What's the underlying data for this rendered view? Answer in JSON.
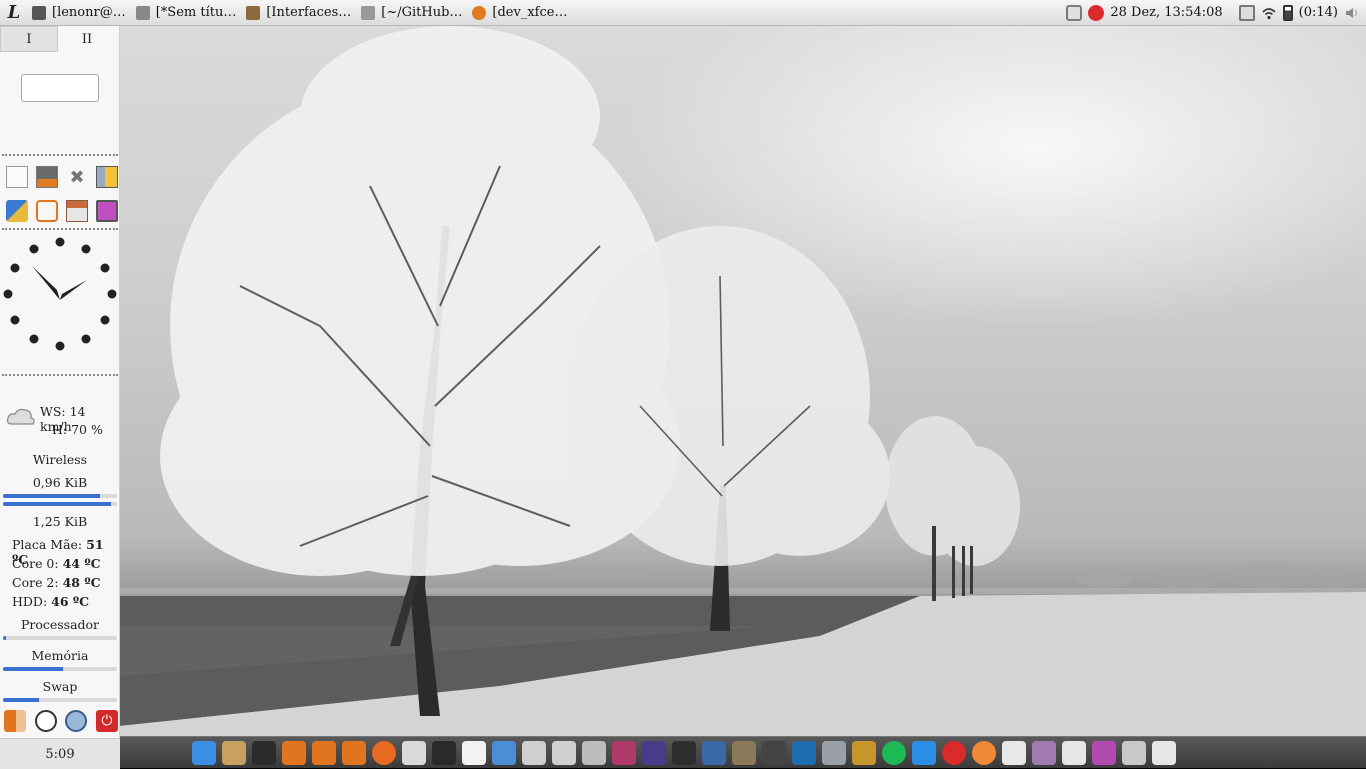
{
  "top_panel": {
    "menu_logo": "L",
    "tasks": [
      {
        "label": "[lenonr@…",
        "icon": "terminal-icon",
        "color": "#555555"
      },
      {
        "label": "[*Sem títu…",
        "icon": "text-editor-icon",
        "color": "#888888"
      },
      {
        "label": "[Interfaces…",
        "icon": "file-manager-icon",
        "color": "#8a6a3a"
      },
      {
        "label": "[~/GitHub…",
        "icon": "editor-pen-icon",
        "color": "#999999"
      },
      {
        "label": "[dev_xfce…",
        "icon": "firefox-icon",
        "color": "#e07b20"
      }
    ],
    "tray": {
      "clock_text": "28 Dez, 13:54:08",
      "battery_text": "(0:14)",
      "icons": [
        "dropbox-sync-icon",
        "mega-icon",
        "clipboard-icon",
        "wifi-icon",
        "battery-icon",
        "volume-icon"
      ]
    }
  },
  "sidebar": {
    "workspaces": [
      {
        "label": "I",
        "active": true
      },
      {
        "label": "II",
        "active": false
      }
    ],
    "launchers": [
      "notes-icon",
      "screenshot-icon",
      "close-x-icon",
      "battery-manager-icon",
      "cleaner-brush-icon",
      "xampp-icon",
      "archive-manager-icon",
      "window-manager-icon"
    ],
    "weather": {
      "wind": "WS: 14 km/h",
      "humidity": "H: 70 %"
    },
    "network": {
      "label": "Wireless",
      "down_rate": "0,96 KiB",
      "up_rate": "1,25 KiB",
      "down_level": 0.85,
      "up_level": 0.95
    },
    "temps": [
      {
        "label": "Placa Mãe:",
        "value": "51 ºC"
      },
      {
        "label": "Core 0:",
        "value": "44 ºC"
      },
      {
        "label": "Core 2:",
        "value": "48 ºC"
      },
      {
        "label": "HDD:",
        "value": "46 ºC"
      }
    ],
    "processor": {
      "label": "Processador",
      "level": 0.03
    },
    "memory": {
      "label": "Memória",
      "level": 0.53
    },
    "swap": {
      "label": "Swap",
      "level": 0.32
    },
    "system_buttons": [
      "logout-icon",
      "clock-settings-icon",
      "network-settings-icon",
      "power-icon"
    ],
    "uptime": "5:09"
  },
  "dock": [
    {
      "icon": "desktop-icon",
      "color": "#3a8ee6"
    },
    {
      "icon": "file-manager-icon",
      "color": "#c8a060"
    },
    {
      "icon": "app-grid-icon",
      "color": "#2b2b2b"
    },
    {
      "icon": "workspace-grid-icon",
      "color": "#e0741f"
    },
    {
      "icon": "workspace-grid-icon",
      "color": "#e0741f"
    },
    {
      "icon": "workspace-grid-icon",
      "color": "#e0741f"
    },
    {
      "icon": "firefox-icon",
      "color": "#e66a1f"
    },
    {
      "icon": "text-editor-icon",
      "color": "#d9d9d9"
    },
    {
      "icon": "terminal-icon",
      "color": "#2a2a2a"
    },
    {
      "icon": "document-icon",
      "color": "#f2f2f2"
    },
    {
      "icon": "writer-icon",
      "color": "#4a8fd6"
    },
    {
      "icon": "camera-icon",
      "color": "#cfcfcf"
    },
    {
      "icon": "draw-icon",
      "color": "#d0d0d0"
    },
    {
      "icon": "calculator-icon",
      "color": "#bdbdbd"
    },
    {
      "icon": "media-player-icon",
      "color": "#b03a6a"
    },
    {
      "icon": "astronomy-icon",
      "color": "#4a3a8a"
    },
    {
      "icon": "system-monitor-icon",
      "color": "#2e2e2e"
    },
    {
      "icon": "code-editor-icon",
      "color": "#3a6aa8"
    },
    {
      "icon": "gimp-icon",
      "color": "#8a7a5a"
    },
    {
      "icon": "inkscape-icon",
      "color": "#444444"
    },
    {
      "icon": "curve-icon",
      "color": "#1f6fb0"
    },
    {
      "icon": "disk-usage-icon",
      "color": "#9aa0a8"
    },
    {
      "icon": "honeycomb-icon",
      "color": "#c8962a"
    },
    {
      "icon": "spotify-icon",
      "color": "#1db954"
    },
    {
      "icon": "dropbox-icon",
      "color": "#2a8ee6"
    },
    {
      "icon": "mega-icon",
      "color": "#d92b2b"
    },
    {
      "icon": "melon-icon",
      "color": "#f08a3a"
    },
    {
      "icon": "tex-icon",
      "color": "#e8e8e8"
    },
    {
      "icon": "archive-icon",
      "color": "#a07ab0"
    },
    {
      "icon": "window-export-icon",
      "color": "#e6e6e6"
    },
    {
      "icon": "window-manager-icon",
      "color": "#b04ab0"
    },
    {
      "icon": "trash-icon",
      "color": "#c8c8c8"
    },
    {
      "icon": "window-move-icon",
      "color": "#e6e6e6"
    }
  ],
  "colors": {
    "bar_fill": "#3b6fd0",
    "power_red": "#d42a2a",
    "panel_bg": "#f7f7f7"
  }
}
